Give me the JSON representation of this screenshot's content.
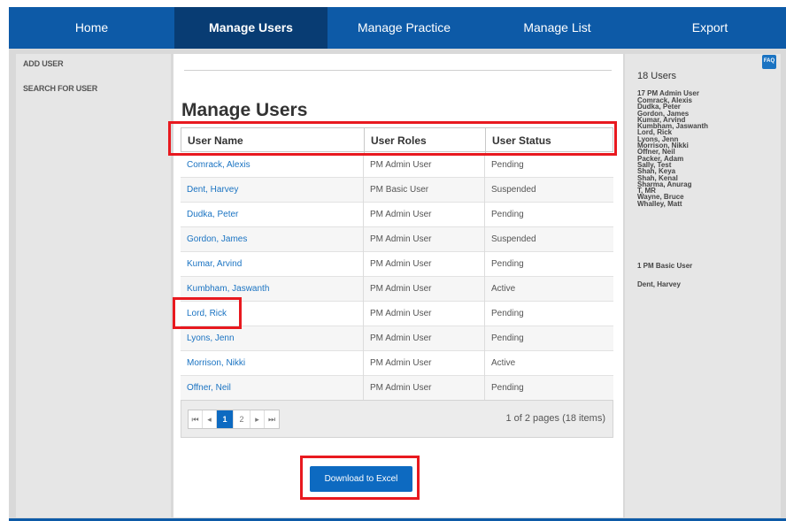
{
  "nav": {
    "tabs": [
      {
        "label": "Home",
        "active": false
      },
      {
        "label": "Manage Users",
        "active": true
      },
      {
        "label": "Manage Practice",
        "active": false
      },
      {
        "label": "Manage List",
        "active": false
      },
      {
        "label": "Export",
        "active": false
      }
    ]
  },
  "sidebar": {
    "items": [
      {
        "label": "ADD USER"
      },
      {
        "label": "SEARCH FOR USER"
      }
    ]
  },
  "main": {
    "title": "Manage Users",
    "columns": [
      "User Name",
      "User Roles",
      "User Status"
    ],
    "rows": [
      {
        "name": "Comrack, Alexis",
        "role": "PM Admin User",
        "status": "Pending"
      },
      {
        "name": "Dent, Harvey",
        "role": "PM Basic User",
        "status": "Suspended"
      },
      {
        "name": "Dudka, Peter",
        "role": "PM Admin User",
        "status": "Pending"
      },
      {
        "name": "Gordon, James",
        "role": "PM Admin User",
        "status": "Suspended"
      },
      {
        "name": "Kumar, Arvind",
        "role": "PM Admin User",
        "status": "Pending"
      },
      {
        "name": "Kumbham, Jaswanth",
        "role": "PM Admin User",
        "status": "Active"
      },
      {
        "name": "Lord, Rick",
        "role": "PM Admin User",
        "status": "Pending"
      },
      {
        "name": "Lyons, Jenn",
        "role": "PM Admin User",
        "status": "Pending"
      },
      {
        "name": "Morrison, Nikki",
        "role": "PM Admin User",
        "status": "Active"
      },
      {
        "name": "Offner, Neil",
        "role": "PM Admin User",
        "status": "Pending"
      }
    ],
    "pager": {
      "first": "⏮",
      "prev": "◂",
      "pages": [
        "1",
        "2"
      ],
      "current_page": "1",
      "next": "▸",
      "last": "⏭",
      "info": "1 of 2 pages (18 items)"
    },
    "download_label": "Download to Excel"
  },
  "right_panel": {
    "faq_label": "FAQ",
    "total": "18 Users",
    "admin_group": "17  PM Admin User",
    "admin_users": [
      "Comrack, Alexis",
      "Dudka, Peter",
      "Gordon, James",
      "Kumar, Arvind",
      "Kumbham, Jaswanth",
      "Lord, Rick",
      "Lyons, Jenn",
      "Morrison, Nikki",
      "Offner, Neil",
      "Packer, Adam",
      "Sally, Test",
      "Shah, Keya",
      "Shah, Kenal",
      "Sharma, Anurag",
      "T, MR",
      "Wayne, Bruce",
      "Whalley, Matt"
    ],
    "basic_group": "1  PM Basic User",
    "basic_users": [
      "Dent, Harvey"
    ]
  },
  "colors": {
    "nav_bg": "#0d5aa7",
    "nav_active": "#083c73",
    "link": "#1a73c2",
    "button": "#0d6ac1",
    "highlight": "#e8191f"
  }
}
